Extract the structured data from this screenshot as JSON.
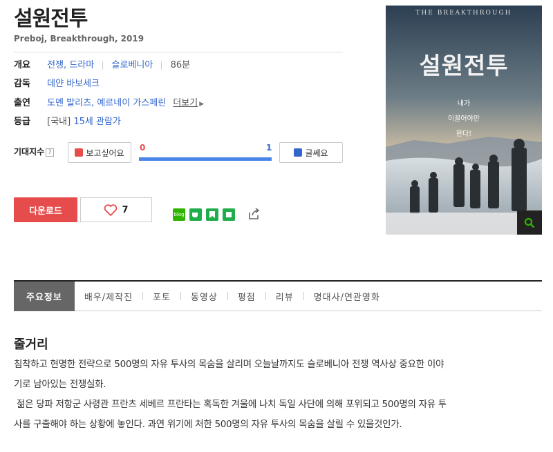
{
  "movie": {
    "title": "설원전투",
    "subtitle": "Preboj, Breakthrough, 2019"
  },
  "info": {
    "overview_label": "개요",
    "genre": "전쟁, 드라마",
    "country": "슬로베니아",
    "runtime": "86분",
    "director_label": "감독",
    "director": "데얀 바보세크",
    "cast_label": "출연",
    "cast": "도멘 발리츠, 예르네이 가스페린",
    "more_label": "더보기",
    "rating_label": "등급",
    "rating_region": "[국내]",
    "rating": "15세 관람가"
  },
  "expectation": {
    "label": "기대지수",
    "help": "?",
    "want_label": "보고싶어요",
    "want_count": "0",
    "nope_label": "글쎄요",
    "nope_count": "1",
    "want_ratio": 0
  },
  "actions": {
    "download_label": "다운로드",
    "like_count": "7",
    "blog_icon_text": "blog"
  },
  "poster": {
    "top_text": "THE BREAKTHROUGH",
    "title": "설원전투",
    "tagline_1": "내가",
    "tagline_2": "이끌어야만",
    "tagline_3": "한다!"
  },
  "tabs": [
    {
      "label": "주요정보"
    },
    {
      "label": "배우/제작진"
    },
    {
      "label": "포토"
    },
    {
      "label": "동영상"
    },
    {
      "label": "평점"
    },
    {
      "label": "리뷰"
    },
    {
      "label": "명대사/연관영화"
    }
  ],
  "synopsis": {
    "heading": "줄거리",
    "line1": "침착하고 현명한 전략으로 500명의 자유 투사의 목숨을 살리며 오늘날까지도 슬로베니아 전쟁 역사상 중요한 이야",
    "line2": "기로 남아있는 전쟁실화.",
    "line3": " 젊은 당파 저항군 사령관 프란츠 세베르 프란타는 혹독한 겨울에 나치 독일 사단에 의해 포위되고 500명의 자유 투",
    "line4": "사를 구출해야 하는 상황에 놓인다. 과연 위기에 처한 500명의 자유 투사의 목숨을 살릴 수 있을것인가."
  },
  "colors": {
    "accent_blue": "#3366cc",
    "download_red": "#e74c4c",
    "gauge_blue": "#4a86e8",
    "active_tab": "#666666"
  }
}
